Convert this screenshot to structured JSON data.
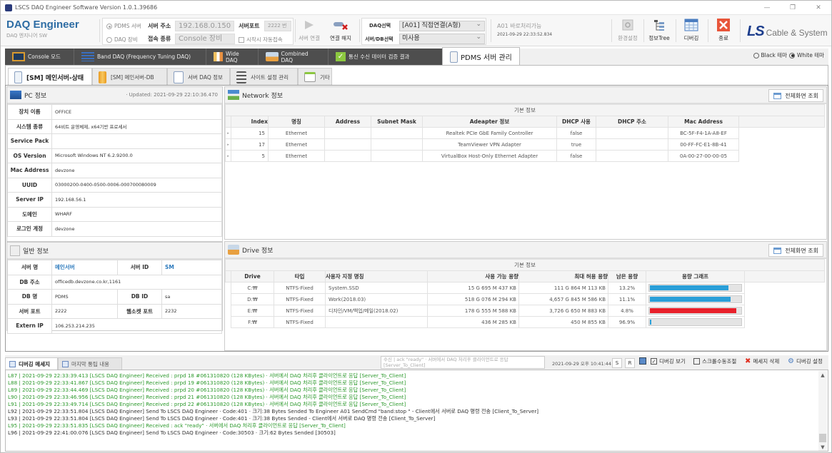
{
  "window": {
    "title": "LSCS DAQ Engineer Software Version 1.0.1.39686",
    "controls": [
      "—",
      "❐",
      "✕"
    ]
  },
  "brand": {
    "title": "DAQ Engineer",
    "subtitle": "DAQ 엔지니어 SW"
  },
  "connection": {
    "mode_pdms": "PDMS 서버",
    "mode_daq": "DAQ 장비",
    "server_addr_label": "서버 주소",
    "server_addr_value": "192.168.0.150",
    "server_port_label": "서버포트",
    "server_port_value": "2222 번",
    "conn_type_label": "접속 종류",
    "conn_type_value": "Console 장비",
    "auto_connect_label": "시작시 자동접속"
  },
  "toolbar": {
    "connect_label": "서버 연결",
    "disconnect_label": "연결 해지",
    "settings_label": "환경설정",
    "infotree_label": "정보Tree",
    "debug_label": "디버깅",
    "exit_label": "종료"
  },
  "daq_select": {
    "daq_label": "DAQ선택",
    "daq_value": "[A01] 직접연결(A형)",
    "server_db_label": "서버/DB선택",
    "server_db_value": "미사용",
    "status_text": "A01 바로처리가능",
    "status_time": "2021-09-29 22:33:52.834"
  },
  "logo": {
    "ls": "LS",
    "text": "Cable & System"
  },
  "main_tabs": [
    {
      "label": "Console 모드",
      "icon": "monitor-icon"
    },
    {
      "label": "Band DAQ (Frequency Tuning DAQ)",
      "icon": "band-icon"
    },
    {
      "label": "Wide DAQ",
      "icon": "grid-icon"
    },
    {
      "label": "Combined DAQ",
      "icon": "drive-icon"
    },
    {
      "label": "통신 수신 데이터 검증 결과",
      "icon": "check-icon"
    },
    {
      "label": "PDMS 서버 관리",
      "icon": "server-icon",
      "active": true
    }
  ],
  "theme": {
    "black_label": "Black 테마",
    "white_label": "White 테마",
    "selected": "White"
  },
  "sub_tabs": [
    {
      "label": "[SM] 메인서버-상태",
      "active": true
    },
    {
      "label": "[SM] 메인서버-DB"
    },
    {
      "label": "서버 DAQ 정보"
    },
    {
      "label": "사이트 설정 관리"
    },
    {
      "label": "기타"
    }
  ],
  "pc_info": {
    "title": "PC 정보",
    "updated": "· Updated:  2021-09-29 22:10:36.470",
    "rows": [
      {
        "key": "장치 이름",
        "value": "OFFICE"
      },
      {
        "key": "시스템 종류",
        "value": "64비트 운영체제, x64기반 프로세서"
      },
      {
        "key": "Service Pack",
        "value": ""
      },
      {
        "key": "OS Version",
        "value": "Microsoft Windows NT 6.2.9200.0"
      },
      {
        "key": "Mac Address",
        "value": "devzone"
      },
      {
        "key": "UUID",
        "value": "03000200-0400-0500-0006-000700080009"
      },
      {
        "key": "Server IP",
        "value": "192.168.56.1"
      },
      {
        "key": "도메인",
        "value": "WHARF"
      },
      {
        "key": "로그인 계정",
        "value": "devzone"
      }
    ]
  },
  "general_info": {
    "title": "일반 정보",
    "server_name_label": "서버 명",
    "server_name_value": "메인서버",
    "server_id_label": "서버 ID",
    "server_id_value": "SM",
    "db_addr_label": "DB 주소",
    "db_addr_value": "officedb.devzone.co.kr,1161",
    "db_name_label": "DB 명",
    "db_name_value": "PDMS",
    "db_id_label": "DB ID",
    "db_id_value": "sa",
    "server_port_label": "서버 포트",
    "server_port_value": "2222",
    "websocket_port_label": "웹소켓 포트",
    "websocket_port_value": "2232",
    "extern_ip_label": "Extern IP",
    "extern_ip_value": "106.253.214.235"
  },
  "network": {
    "title": "Network 정보",
    "full_view": "전체화면 조회",
    "group_header": "기본 정보",
    "columns": [
      "Index",
      "명칭",
      "Address",
      "Subnet Mask",
      "Adeapter 정보",
      "DHCP 사용",
      "DHCP 주소",
      "Mac Address"
    ],
    "rows": [
      [
        "15",
        "Ethernet",
        "",
        "",
        "Realtek PCIe GbE Family Controller",
        "false",
        "",
        "BC-5F-F4-1A-A8-EF"
      ],
      [
        "17",
        "Ethernet",
        "",
        "",
        "TeamViewer VPN Adapter",
        "true",
        "",
        "00-FF-FC-E1-8B-41"
      ],
      [
        "5",
        "Ethernet",
        "",
        "",
        "VirtualBox Host-Only Ethernet Adapter",
        "false",
        "",
        "0A-00-27-00-00-05"
      ]
    ]
  },
  "drive": {
    "title": "Drive 정보",
    "full_view": "전체화면 조회",
    "group_header": "기본 정보",
    "columns": [
      "Drive",
      "타입",
      "사용자 지정 명칭",
      "사용 가능 용량",
      "최대 허용 용량",
      "남은 용량",
      "용량 그래프"
    ],
    "rows": [
      {
        "drive": "C:₩",
        "type": "NTFS-Fixed",
        "name": "System.SSD",
        "avail": "15 G 695 M 437 KB",
        "max": "111 G 864 M 113 KB",
        "remain": "13.2%",
        "used_pct": 86.8,
        "color": "#2a9fd8"
      },
      {
        "drive": "D:₩",
        "type": "NTFS-Fixed",
        "name": "Work(2018.03)",
        "avail": "518 G 076 M 294 KB",
        "max": "4,657 G 845 M 586 KB",
        "remain": "11.1%",
        "used_pct": 88.9,
        "color": "#2a9fd8"
      },
      {
        "drive": "E:₩",
        "type": "NTFS-Fixed",
        "name": "디자인/VM/백업/메일(2018.02)",
        "avail": "178 G 555 M 588 KB",
        "max": "3,726 G 650 M 883 KB",
        "remain": "4.8%",
        "used_pct": 95.2,
        "color": "#e8202a"
      },
      {
        "drive": "F:₩",
        "type": "NTFS-Fixed",
        "name": "",
        "avail": "436 M 285 KB",
        "max": "450 M 855 KB",
        "remain": "96.9%",
        "used_pct": 3.1,
        "color": "#2a9fd8"
      }
    ]
  },
  "debug": {
    "tab_debug": "디버깅 메세지",
    "tab_last": "마지막 통팁 내용",
    "last_msg": "수신 | ack \"ready\" · 서버에서 DAQ 처리후 클라이언트로 응답 [Server_To_Client]",
    "timestamp": "2021-09-29 오후 10:41:44",
    "s_btn": "S",
    "r_btn": "R",
    "show_debug": "디버깅 보기",
    "scroll_manual": "스크롤수동조절",
    "delete_msg": "메세지 삭제",
    "debug_settings": "디버깅 설정",
    "log": [
      {
        "text": "L87 |  2021-09-29 22:33:39.413 [LSCS DAQ Engineer] Received   : prpd 18 #061310820 (128 KBytes)  · 서버에서 DAQ 처리후 클라이언트로 응답 [Server_To_Client]",
        "color": "green"
      },
      {
        "text": "L88 |  2021-09-29 22:33:41.867 [LSCS DAQ Engineer] Received   : prpd 19 #061310820 (128 KBytes)  · 서버에서 DAQ 처리후 클라이언트로 응답 [Server_To_Client]",
        "color": "green"
      },
      {
        "text": "L89 |  2021-09-29 22:33:44.469 [LSCS DAQ Engineer] Received   : prpd 20 #061310820 (128 KBytes)  · 서버에서 DAQ 처리후 클라이언트로 응답 [Server_To_Client]",
        "color": "green"
      },
      {
        "text": "L90 |  2021-09-29 22:33:46.956 [LSCS DAQ Engineer] Received   : prpd 21 #061310820 (128 KBytes)  · 서버에서 DAQ 처리후 클라이언트로 응답 [Server_To_Client]",
        "color": "green"
      },
      {
        "text": "L91 |  2021-09-29 22:33:49.714 [LSCS DAQ Engineer] Received   : prpd 22 #061310820 (128 KBytes)  · 서버에서 DAQ 처리후 클라이언트로 응답 [Server_To_Client]",
        "color": "green"
      },
      {
        "text": "L92 |  2021-09-29 22:33:51.804 [LSCS DAQ Engineer] Send To LSCS DAQ Engineer  · Code:401  · 크기:38 Bytes Sended To Engineer A01 SendCmd \"band:stop \" - Client에서 서버로 DAQ 명령 전송 [Client_To_Server]",
        "color": "dark"
      },
      {
        "text": "L93 |  2021-09-29 22:33:51.804 [LSCS DAQ Engineer] Send To LSCS DAQ Engineer  · Code:401  · 크기:38 Bytes Sended - Client에서 서버로 DAQ 명령 전송 [Client_To_Server]",
        "color": "dark"
      },
      {
        "text": "L95 |  2021-09-29 22:33:51.835 [LSCS DAQ Engineer] Received   : ack \"ready\"  · 서버에서 DAQ 처리후 클라이언트로 응답 [Server_To_Client]",
        "color": "green"
      },
      {
        "text": "L96 |  2021-09-29 22:41:00.076 [LSCS DAQ Engineer] Send To LSCS DAQ Engineer  · Code:30503  · 크기:62 Bytes Sended [30503]",
        "color": "dark"
      }
    ]
  }
}
